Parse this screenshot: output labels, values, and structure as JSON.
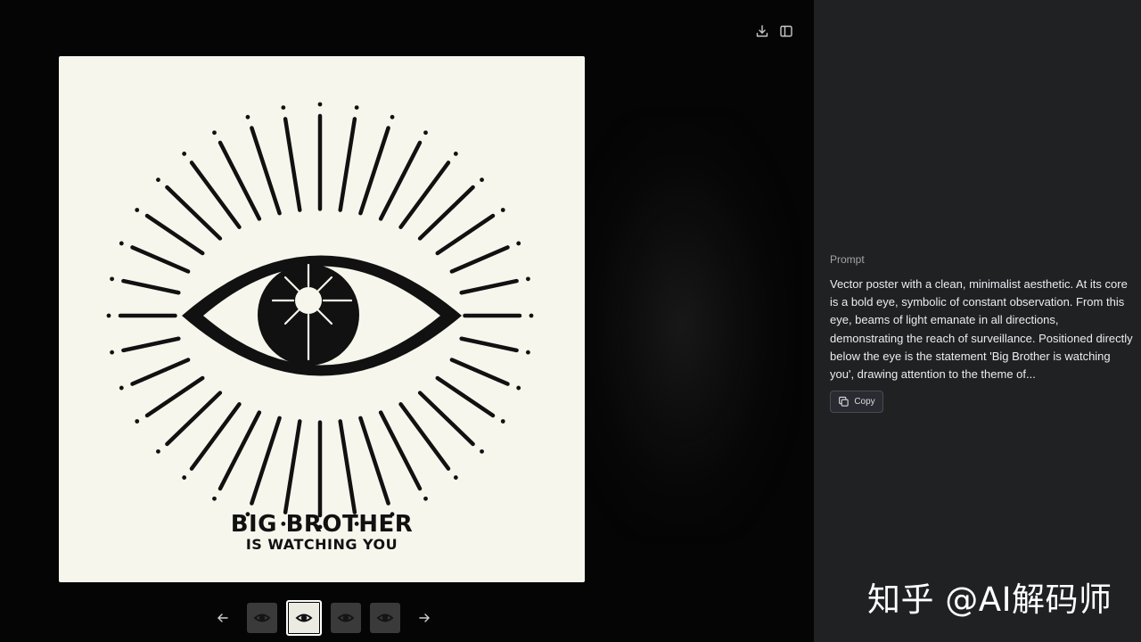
{
  "toolbar": {
    "download_icon": "download-icon",
    "sidebar_toggle_icon": "sidebar-toggle-icon"
  },
  "image": {
    "headline": "BIG BROTHER",
    "subline": "IS WATCHING YOU",
    "background_color": "#f7f6ed",
    "ink_color": "#111111"
  },
  "thumbnails": {
    "prev_icon": "arrow-left-icon",
    "next_icon": "arrow-right-icon",
    "count": 4,
    "active_index": 1
  },
  "panel": {
    "label": "Prompt",
    "text": "Vector poster with a clean, minimalist aesthetic. At its core is a bold eye, symbolic of constant observation. From this eye, beams of light emanate in all directions, demonstrating the reach of surveillance. Positioned directly below the eye is the statement 'Big Brother is watching you', drawing attention to the theme of...",
    "copy_label": "Copy",
    "copy_icon": "copy-icon"
  },
  "watermark": "知乎 @AI解码师",
  "colors": {
    "viewer_bg": "#050505",
    "panel_bg": "#202123",
    "text": "#ececf1",
    "muted": "#a3a3a8"
  }
}
